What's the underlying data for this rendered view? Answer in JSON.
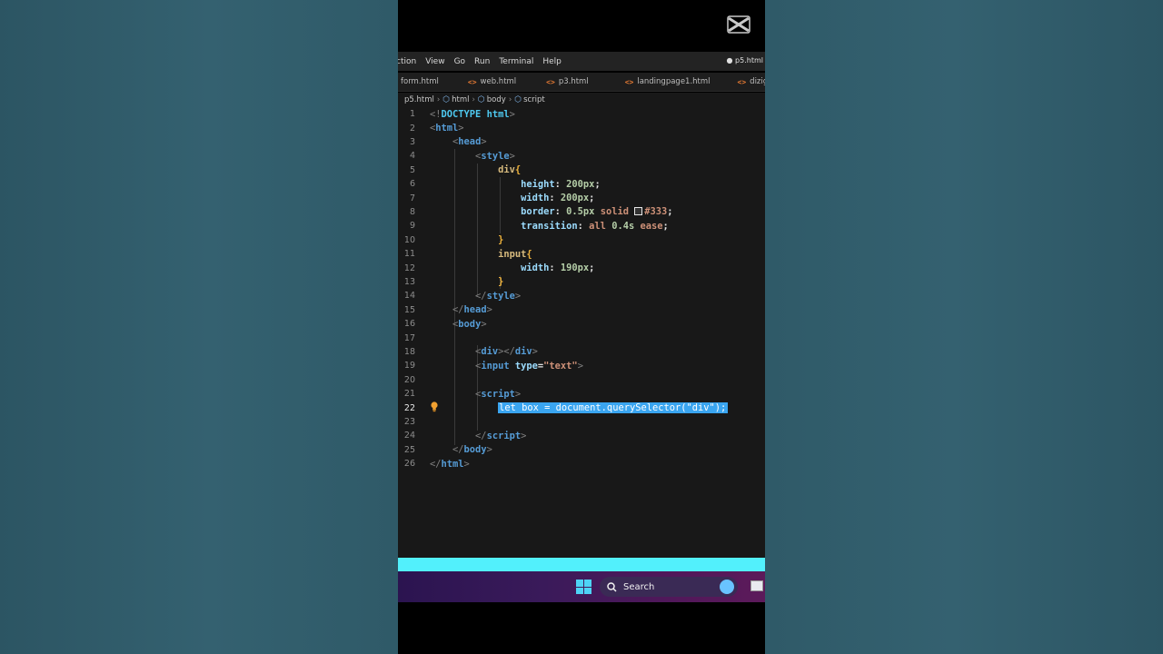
{
  "menubar": {
    "items": [
      "ction",
      "View",
      "Go",
      "Run",
      "Terminal",
      "Help"
    ],
    "active_file": "● p5.html"
  },
  "tabs": [
    {
      "icon": "",
      "label": "form.html"
    },
    {
      "icon": "<>",
      "label": "web.html"
    },
    {
      "icon": "<>",
      "label": "p3.html"
    },
    {
      "icon": "<>",
      "label": "landingpage1.html"
    },
    {
      "icon": "<>",
      "label": "dizigo.h"
    }
  ],
  "breadcrumb": [
    "p5.html",
    "html",
    "body",
    "script"
  ],
  "current_line": 22,
  "lines": [
    {
      "n": "1",
      "tokens": [
        [
          "p",
          "<!"
        ],
        [
          "tagc",
          "DOCTYPE"
        ],
        [
          "w",
          " "
        ],
        [
          "tagc",
          "html"
        ],
        [
          "p",
          ">"
        ]
      ]
    },
    {
      "n": "2",
      "tokens": [
        [
          "p",
          "<"
        ],
        [
          "tag",
          "html"
        ],
        [
          "p",
          ">"
        ]
      ]
    },
    {
      "n": "3",
      "tokens": [
        [
          "w",
          "    "
        ],
        [
          "p",
          "<"
        ],
        [
          "tag",
          "head"
        ],
        [
          "p",
          ">"
        ]
      ]
    },
    {
      "n": "4",
      "tokens": [
        [
          "w",
          "        "
        ],
        [
          "p",
          "<"
        ],
        [
          "tag",
          "style"
        ],
        [
          "p",
          ">"
        ]
      ]
    },
    {
      "n": "5",
      "tokens": [
        [
          "w",
          "            "
        ],
        [
          "sel",
          "div"
        ],
        [
          "br",
          "{"
        ]
      ]
    },
    {
      "n": "6",
      "tokens": [
        [
          "w",
          "                "
        ],
        [
          "prop",
          "height"
        ],
        [
          "w",
          ": "
        ],
        [
          "num",
          "200px"
        ],
        [
          "w",
          ";"
        ]
      ]
    },
    {
      "n": "7",
      "tokens": [
        [
          "w",
          "                "
        ],
        [
          "prop",
          "width"
        ],
        [
          "w",
          ": "
        ],
        [
          "num",
          "200px"
        ],
        [
          "w",
          ";"
        ]
      ]
    },
    {
      "n": "8",
      "tokens": [
        [
          "w",
          "                "
        ],
        [
          "prop",
          "border"
        ],
        [
          "w",
          ": "
        ],
        [
          "num",
          "0.5px"
        ],
        [
          "w",
          " "
        ],
        [
          "kw",
          "solid"
        ],
        [
          "w",
          " "
        ],
        [
          "swatch",
          ""
        ],
        [
          "kw",
          "#333"
        ],
        [
          "w",
          ";"
        ]
      ]
    },
    {
      "n": "9",
      "tokens": [
        [
          "w",
          "                "
        ],
        [
          "prop",
          "transition"
        ],
        [
          "w",
          ": "
        ],
        [
          "kw",
          "all"
        ],
        [
          "w",
          " "
        ],
        [
          "num",
          "0.4s"
        ],
        [
          "w",
          " "
        ],
        [
          "kw",
          "ease"
        ],
        [
          "w",
          ";"
        ]
      ]
    },
    {
      "n": "10",
      "tokens": [
        [
          "w",
          "            "
        ],
        [
          "br",
          "}"
        ]
      ]
    },
    {
      "n": "11",
      "tokens": [
        [
          "w",
          "            "
        ],
        [
          "sel",
          "input"
        ],
        [
          "br",
          "{"
        ]
      ]
    },
    {
      "n": "12",
      "tokens": [
        [
          "w",
          "                "
        ],
        [
          "prop",
          "width"
        ],
        [
          "w",
          ": "
        ],
        [
          "num",
          "190px"
        ],
        [
          "w",
          ";"
        ]
      ]
    },
    {
      "n": "13",
      "tokens": [
        [
          "w",
          "            "
        ],
        [
          "br",
          "}"
        ]
      ]
    },
    {
      "n": "14",
      "tokens": [
        [
          "w",
          "        "
        ],
        [
          "p",
          "</"
        ],
        [
          "tag",
          "style"
        ],
        [
          "p",
          ">"
        ]
      ]
    },
    {
      "n": "15",
      "tokens": [
        [
          "w",
          "    "
        ],
        [
          "p",
          "</"
        ],
        [
          "tag",
          "head"
        ],
        [
          "p",
          ">"
        ]
      ]
    },
    {
      "n": "16",
      "tokens": [
        [
          "w",
          "    "
        ],
        [
          "p",
          "<"
        ],
        [
          "tag",
          "body"
        ],
        [
          "p",
          ">"
        ]
      ]
    },
    {
      "n": "17",
      "tokens": []
    },
    {
      "n": "18",
      "tokens": [
        [
          "w",
          "        "
        ],
        [
          "p",
          "<"
        ],
        [
          "tag",
          "div"
        ],
        [
          "p",
          "></"
        ],
        [
          "tag",
          "div"
        ],
        [
          "p",
          ">"
        ]
      ]
    },
    {
      "n": "19",
      "tokens": [
        [
          "w",
          "        "
        ],
        [
          "p",
          "<"
        ],
        [
          "tag",
          "input"
        ],
        [
          "w",
          " "
        ],
        [
          "attr",
          "type"
        ],
        [
          "w",
          "="
        ],
        [
          "str",
          "\"text\""
        ],
        [
          "p",
          ">"
        ]
      ]
    },
    {
      "n": "20",
      "tokens": []
    },
    {
      "n": "21",
      "tokens": [
        [
          "w",
          "        "
        ],
        [
          "p",
          "<"
        ],
        [
          "tag",
          "script"
        ],
        [
          "p",
          ">"
        ]
      ]
    },
    {
      "n": "22",
      "tokens": [
        [
          "w",
          "            "
        ],
        [
          "hl",
          "let box = document.querySelector(\"div\");"
        ]
      ]
    },
    {
      "n": "23",
      "tokens": []
    },
    {
      "n": "24",
      "tokens": [
        [
          "w",
          "        "
        ],
        [
          "p",
          "</"
        ],
        [
          "tag",
          "script"
        ],
        [
          "p",
          ">"
        ]
      ]
    },
    {
      "n": "25",
      "tokens": [
        [
          "w",
          "    "
        ],
        [
          "p",
          "</"
        ],
        [
          "tag",
          "body"
        ],
        [
          "p",
          ">"
        ]
      ]
    },
    {
      "n": "26",
      "tokens": [
        [
          "p",
          "</"
        ],
        [
          "tag",
          "html"
        ],
        [
          "p",
          ">"
        ]
      ]
    }
  ],
  "taskbar": {
    "search_label": "Search"
  },
  "colors": {
    "selection": "#3aa5f0",
    "taskbar_accent": "#52f0fc"
  }
}
